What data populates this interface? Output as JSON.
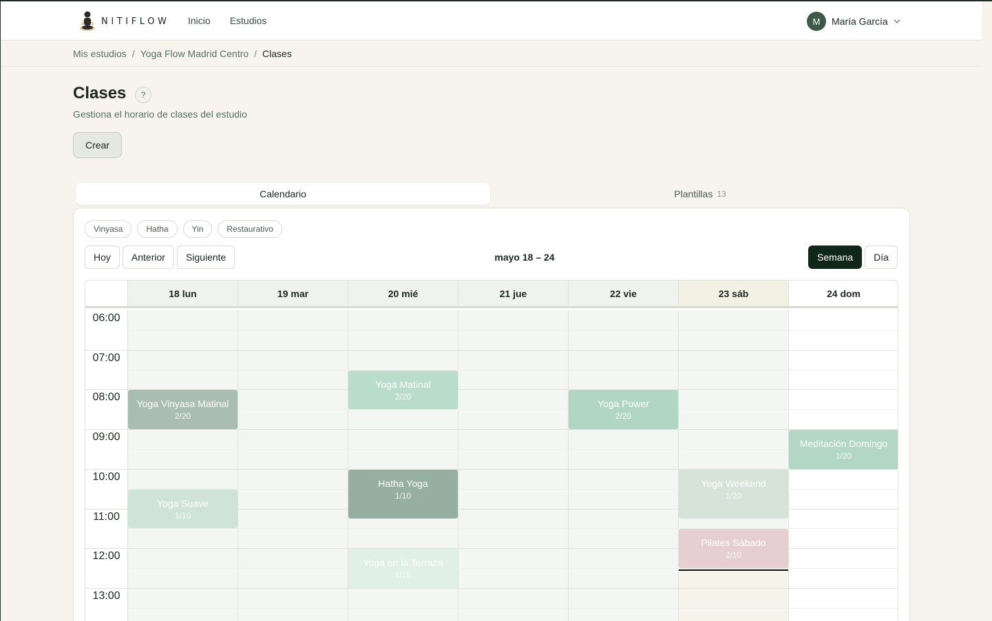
{
  "brand": {
    "name": "NITIFLOW"
  },
  "nav": {
    "items": [
      "Inicio",
      "Estudios"
    ]
  },
  "user": {
    "initial": "M",
    "name": "María García"
  },
  "breadcrumb": [
    "Mis estudios",
    "Yoga Flow Madrid Centro",
    "Clases"
  ],
  "page": {
    "title": "Clases",
    "help": "?",
    "subtitle": "Gestiona el horario de clases del estudio",
    "create_label": "Crear"
  },
  "tabs": {
    "calendar": "Calendario",
    "templates": "Plantillas",
    "templates_count": "13"
  },
  "filters": [
    "Vinyasa",
    "Hatha",
    "Yin",
    "Restaurativo"
  ],
  "toolbar": {
    "today": "Hoy",
    "prev": "Anterior",
    "next": "Siguiente",
    "range": "mayo 18 – 24",
    "week": "Semana",
    "day": "Día"
  },
  "days": [
    "18 lun",
    "19 mar",
    "20 mié",
    "21 jue",
    "22 vie",
    "23 sáb",
    "24 dom"
  ],
  "hours": [
    "06:00",
    "07:00",
    "08:00",
    "09:00",
    "10:00",
    "11:00",
    "12:00",
    "13:00"
  ],
  "events": [
    {
      "name": "Yoga Vinyasa Matinal",
      "count": "2/20",
      "day": 0,
      "start": "08:00",
      "end": "09:00",
      "color": "#a9bdb2"
    },
    {
      "name": "Yoga Suave",
      "count": "1/10",
      "day": 0,
      "start": "10:30",
      "end": "11:30",
      "color": "#cfe3d8"
    },
    {
      "name": "Yoga Matinal",
      "count": "2/20",
      "day": 2,
      "start": "07:30",
      "end": "08:30",
      "color": "#b9dccb"
    },
    {
      "name": "Hatha Yoga",
      "count": "1/10",
      "day": 2,
      "start": "10:00",
      "end": "11:15",
      "color": "#96afa1"
    },
    {
      "name": "Yoga en la Terraza",
      "count": "1/15",
      "day": 2,
      "start": "12:00",
      "end": "13:00",
      "color": "#e0efe7"
    },
    {
      "name": "Yoga Power",
      "count": "2/20",
      "day": 4,
      "start": "08:00",
      "end": "09:00",
      "color": "#b2d6c4"
    },
    {
      "name": "Yoga Weekend",
      "count": "1/20",
      "day": 5,
      "start": "10:00",
      "end": "11:15",
      "color": "#d6e3d9"
    },
    {
      "name": "Pilates Sábado",
      "count": "2/10",
      "day": 5,
      "start": "11:30",
      "end": "12:30",
      "color": "#e6cfd2"
    },
    {
      "name": "Meditación Domingo",
      "count": "1/20",
      "day": 6,
      "start": "09:00",
      "end": "10:00",
      "color": "#b4d6c5"
    }
  ],
  "now": {
    "day": 5,
    "time": "12:32"
  }
}
